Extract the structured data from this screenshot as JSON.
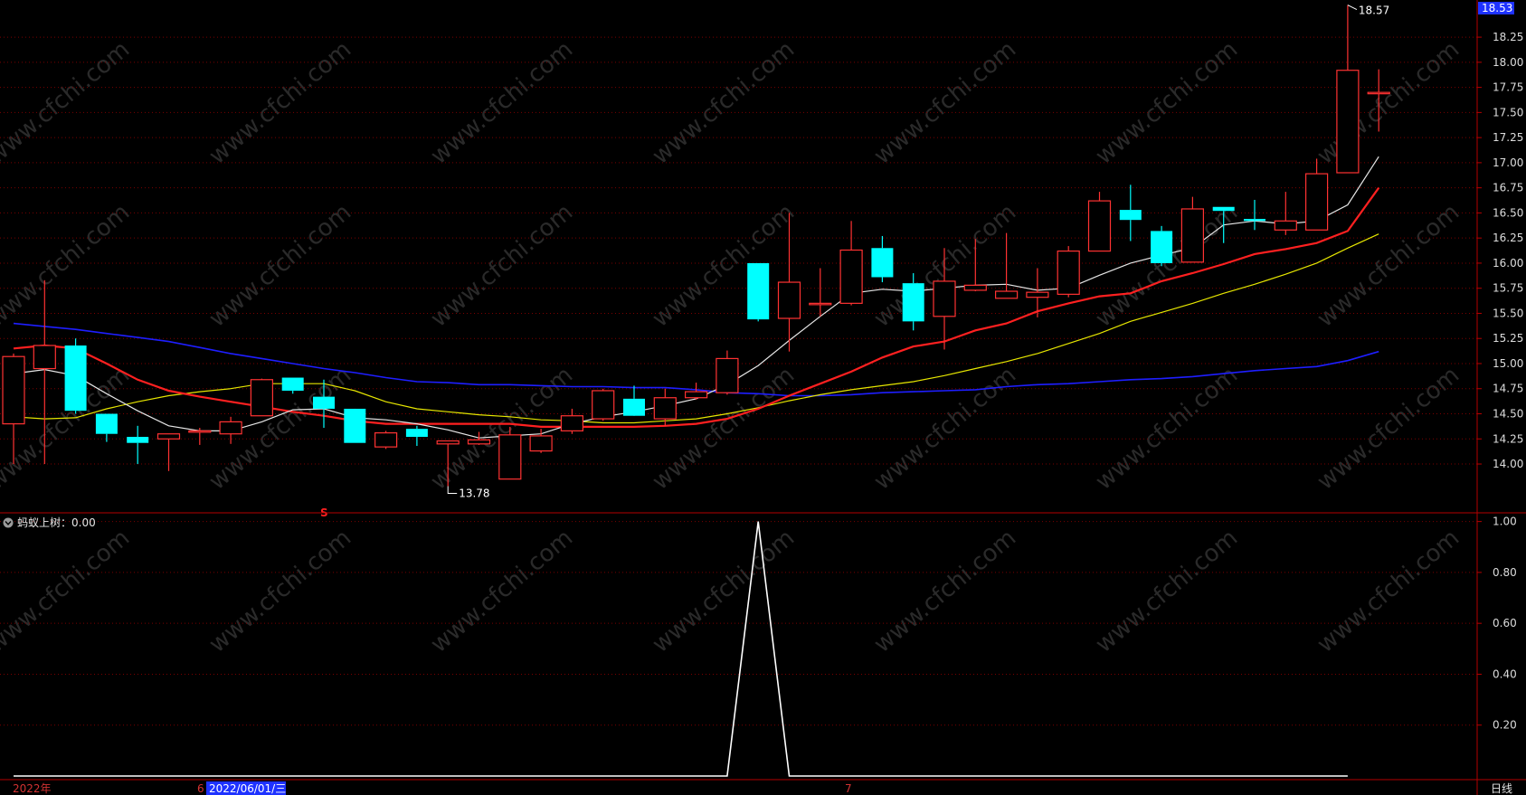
{
  "colors": {
    "up": "#ff3232",
    "down": "#00ffff",
    "axis": "#b40000",
    "grid": "#7a0000",
    "tick_text": "#dcdcdc",
    "ma5": "#e6e6e6",
    "ma10": "#ff2020",
    "ma20": "#e6e600",
    "ma60": "#1e1eff",
    "watermark": "#2a2a2a"
  },
  "watermark_text": "www.cfchi.com",
  "price_panel": {
    "ylim": [
      13.55,
      18.62
    ],
    "y_ticks": [
      "18.25",
      "18.00",
      "17.75",
      "17.50",
      "17.25",
      "17.00",
      "16.75",
      "16.50",
      "16.25",
      "16.00",
      "15.75",
      "15.50",
      "15.25",
      "15.00",
      "14.75",
      "14.50",
      "14.25",
      "14.00"
    ],
    "last_price_label": "18.53",
    "max_label": "18.57",
    "min_label": "13.78",
    "marker_label": "S"
  },
  "indicator": {
    "title_icon": "chevron-down-icon",
    "title": "蚂蚁上树：0.00",
    "ylim": [
      0,
      1.02
    ],
    "y_ticks": [
      "1.00",
      "0.80",
      "0.60",
      "0.40",
      "0.20"
    ],
    "values": [
      0,
      0,
      0,
      0,
      0,
      0,
      0,
      0,
      0,
      0,
      0,
      0,
      0,
      0,
      0,
      0,
      0,
      0,
      0,
      0,
      0,
      0,
      0,
      0,
      1,
      0,
      0,
      0,
      0,
      0,
      0,
      0,
      0,
      0,
      0,
      0,
      0,
      0,
      0,
      0,
      0,
      0,
      0,
      0
    ]
  },
  "footer": {
    "year_label": "2022年",
    "month6_label": "6",
    "date_label": "2022/06/01/三",
    "month7_label": "7",
    "period_label": "日线"
  },
  "chart_data": {
    "type": "candlestick",
    "ohlc": [
      {
        "open": 14.4,
        "high": 15.1,
        "low": 14.0,
        "close": 15.07
      },
      {
        "open": 14.95,
        "high": 15.83,
        "low": 14.0,
        "close": 15.18
      },
      {
        "open": 15.18,
        "high": 15.25,
        "low": 14.5,
        "close": 14.53
      },
      {
        "open": 14.5,
        "high": 14.5,
        "low": 14.22,
        "close": 14.3
      },
      {
        "open": 14.27,
        "high": 14.38,
        "low": 14.0,
        "close": 14.21
      },
      {
        "open": 14.25,
        "high": 14.3,
        "low": 13.93,
        "close": 14.3
      },
      {
        "open": 14.33,
        "high": 14.36,
        "low": 14.19,
        "close": 14.33
      },
      {
        "open": 14.3,
        "high": 14.47,
        "low": 14.2,
        "close": 14.42
      },
      {
        "open": 14.48,
        "high": 14.85,
        "low": 14.48,
        "close": 14.84
      },
      {
        "open": 14.86,
        "high": 14.86,
        "low": 14.7,
        "close": 14.73
      },
      {
        "open": 14.67,
        "high": 14.84,
        "low": 14.36,
        "close": 14.55
      },
      {
        "open": 14.55,
        "high": 14.53,
        "low": 14.21,
        "close": 14.21
      },
      {
        "open": 14.17,
        "high": 14.33,
        "low": 14.15,
        "close": 14.31
      },
      {
        "open": 14.35,
        "high": 14.38,
        "low": 14.18,
        "close": 14.27
      },
      {
        "open": 14.2,
        "high": 14.23,
        "low": 13.78,
        "close": 14.23
      },
      {
        "open": 14.2,
        "high": 14.32,
        "low": 14.19,
        "close": 14.24
      },
      {
        "open": 13.85,
        "high": 14.37,
        "low": 13.85,
        "close": 14.29
      },
      {
        "open": 14.13,
        "high": 14.35,
        "low": 14.11,
        "close": 14.28
      },
      {
        "open": 14.33,
        "high": 14.55,
        "low": 14.3,
        "close": 14.48
      },
      {
        "open": 14.45,
        "high": 14.75,
        "low": 14.43,
        "close": 14.73
      },
      {
        "open": 14.65,
        "high": 14.78,
        "low": 14.5,
        "close": 14.48
      },
      {
        "open": 14.45,
        "high": 14.75,
        "low": 14.38,
        "close": 14.66
      },
      {
        "open": 14.66,
        "high": 14.81,
        "low": 14.64,
        "close": 14.72
      },
      {
        "open": 14.71,
        "high": 15.13,
        "low": 14.69,
        "close": 15.05
      },
      {
        "open": 16.0,
        "high": 16.0,
        "low": 15.42,
        "close": 15.44
      },
      {
        "open": 15.45,
        "high": 16.5,
        "low": 15.12,
        "close": 15.81
      },
      {
        "open": 15.6,
        "high": 15.95,
        "low": 15.47,
        "close": 15.6
      },
      {
        "open": 15.6,
        "high": 16.42,
        "low": 15.58,
        "close": 16.13
      },
      {
        "open": 16.15,
        "high": 16.27,
        "low": 15.81,
        "close": 15.86
      },
      {
        "open": 15.8,
        "high": 15.9,
        "low": 15.33,
        "close": 15.42
      },
      {
        "open": 15.47,
        "high": 16.15,
        "low": 15.14,
        "close": 15.82
      },
      {
        "open": 15.73,
        "high": 16.24,
        "low": 15.72,
        "close": 15.78
      },
      {
        "open": 15.65,
        "high": 16.3,
        "low": 15.65,
        "close": 15.72
      },
      {
        "open": 15.66,
        "high": 15.95,
        "low": 15.46,
        "close": 15.71
      },
      {
        "open": 15.69,
        "high": 16.17,
        "low": 15.66,
        "close": 16.12
      },
      {
        "open": 16.12,
        "high": 16.71,
        "low": 16.12,
        "close": 16.62
      },
      {
        "open": 16.53,
        "high": 16.78,
        "low": 16.22,
        "close": 16.43
      },
      {
        "open": 16.32,
        "high": 16.37,
        "low": 15.97,
        "close": 16.0
      },
      {
        "open": 16.01,
        "high": 16.66,
        "low": 16.01,
        "close": 16.54
      },
      {
        "open": 16.56,
        "high": 16.56,
        "low": 16.2,
        "close": 16.52
      },
      {
        "open": 16.44,
        "high": 16.63,
        "low": 16.33,
        "close": 16.42
      },
      {
        "open": 16.33,
        "high": 16.71,
        "low": 16.28,
        "close": 16.42
      },
      {
        "open": 16.33,
        "high": 17.04,
        "low": 16.33,
        "close": 16.89
      },
      {
        "open": 16.9,
        "high": 18.57,
        "low": 16.9,
        "close": 17.92
      },
      {
        "open": 17.7,
        "high": 17.93,
        "low": 17.31,
        "close": 17.7
      }
    ],
    "ma5": [
      14.9,
      14.94,
      14.88,
      14.7,
      14.53,
      14.38,
      14.33,
      14.33,
      14.42,
      14.54,
      14.55,
      14.46,
      14.44,
      14.4,
      14.34,
      14.26,
      14.28,
      14.3,
      14.4,
      14.47,
      14.52,
      14.58,
      14.65,
      14.79,
      14.98,
      15.23,
      15.47,
      15.7,
      15.74,
      15.72,
      15.75,
      15.78,
      15.79,
      15.73,
      15.75,
      15.88,
      16.0,
      16.08,
      16.15,
      16.38,
      16.42,
      16.39,
      16.42,
      16.58,
      17.06
    ],
    "ma10": [
      15.15,
      15.18,
      15.15,
      15.0,
      14.84,
      14.73,
      14.67,
      14.62,
      14.57,
      14.52,
      14.48,
      14.43,
      14.4,
      14.4,
      14.4,
      14.4,
      14.4,
      14.37,
      14.37,
      14.37,
      14.37,
      14.38,
      14.4,
      14.45,
      14.55,
      14.68,
      14.8,
      14.92,
      15.06,
      15.17,
      15.22,
      15.33,
      15.4,
      15.52,
      15.6,
      15.67,
      15.7,
      15.82,
      15.9,
      15.99,
      16.09,
      16.14,
      16.2,
      16.32,
      16.75
    ],
    "ma20": [
      14.47,
      14.45,
      14.46,
      14.55,
      14.62,
      14.68,
      14.72,
      14.75,
      14.8,
      14.8,
      14.8,
      14.73,
      14.62,
      14.55,
      14.52,
      14.49,
      14.47,
      14.44,
      14.43,
      14.41,
      14.41,
      14.43,
      14.45,
      14.5,
      14.56,
      14.63,
      14.69,
      14.74,
      14.78,
      14.82,
      14.88,
      14.95,
      15.02,
      15.1,
      15.2,
      15.3,
      15.42,
      15.51,
      15.6,
      15.7,
      15.79,
      15.89,
      16.0,
      16.15,
      16.29
    ],
    "ma60": [
      15.4,
      15.37,
      15.34,
      15.3,
      15.26,
      15.22,
      15.16,
      15.1,
      15.05,
      15.0,
      14.95,
      14.91,
      14.86,
      14.82,
      14.81,
      14.79,
      14.79,
      14.78,
      14.77,
      14.77,
      14.76,
      14.76,
      14.74,
      14.71,
      14.7,
      14.68,
      14.68,
      14.69,
      14.71,
      14.72,
      14.73,
      14.74,
      14.77,
      14.79,
      14.8,
      14.82,
      14.84,
      14.85,
      14.87,
      14.9,
      14.93,
      14.95,
      14.97,
      15.03,
      15.12
    ]
  }
}
